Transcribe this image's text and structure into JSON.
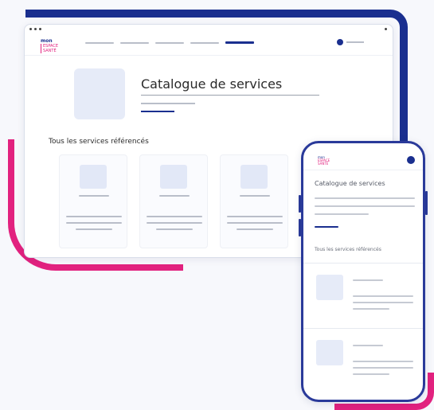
{
  "brand": {
    "logo_line1": "mon",
    "logo_line2": "ESPACE",
    "logo_line3": "SANTÉ"
  },
  "desktop": {
    "page_title": "Catalogue de services",
    "section_title": "Tous les services référencés",
    "cards_count": 3
  },
  "mobile": {
    "page_title": "Catalogue de services",
    "section_title": "Tous les services référencés"
  },
  "colors": {
    "navy": "#1a2f8f",
    "pink": "#e2227f",
    "placeholder": "#e6ebf8",
    "skeleton": "#b9bec9"
  }
}
